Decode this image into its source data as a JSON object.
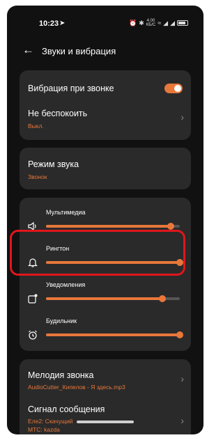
{
  "status": {
    "time": "10:23",
    "speed_top": "4.00",
    "speed_bottom": "КБ/С"
  },
  "header": {
    "title": "Звуки и вибрация"
  },
  "card1": {
    "vibration_label": "Вибрация при звонке",
    "vibration_on": true,
    "dnd_label": "Не беспокоить",
    "dnd_value": "Выкл."
  },
  "card2": {
    "mode_label": "Режим звука",
    "mode_value": "Звонок"
  },
  "volumes": [
    {
      "label": "Мультимедиа",
      "icon": "speaker-icon",
      "level": 0.93
    },
    {
      "label": "Рингтон",
      "icon": "bell-icon",
      "level": 1.0
    },
    {
      "label": "Уведомления",
      "icon": "notification-icon",
      "level": 0.87
    },
    {
      "label": "Будильник",
      "icon": "alarm-clock-icon",
      "level": 1.0
    }
  ],
  "card4": {
    "ringtone_label": "Мелодия звонка",
    "ringtone_value": "AudioCutter_Кипелов - Я здесь.mp3",
    "message_label": "Сигнал сообщения",
    "message_value": "Еле2: Скачущий",
    "message_value2": "МТС: kazda"
  },
  "colors": {
    "accent": "#e8773a",
    "highlight": "#e0161c",
    "card": "#2a2a2a",
    "background": "#111111"
  }
}
